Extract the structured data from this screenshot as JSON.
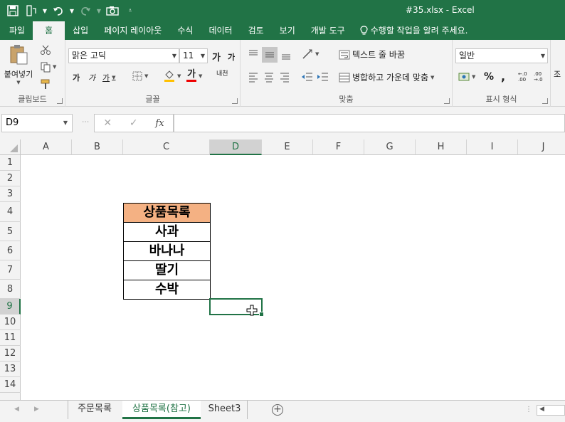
{
  "app": {
    "title": "#35.xlsx - Excel"
  },
  "ribbon_tabs": [
    {
      "label": "파일"
    },
    {
      "label": "홈"
    },
    {
      "label": "삽입"
    },
    {
      "label": "페이지 레이아웃"
    },
    {
      "label": "수식"
    },
    {
      "label": "데이터"
    },
    {
      "label": "검토"
    },
    {
      "label": "보기"
    },
    {
      "label": "개발 도구"
    }
  ],
  "tell_me": "수행할 작업을 알려 주세요.",
  "clipboard": {
    "paste_label": "붙여넣기",
    "group_label": "클립보드"
  },
  "font": {
    "name": "맑은 고딕",
    "size": "11",
    "bold": "가",
    "italic": "가",
    "underline": "가",
    "grow": "가",
    "shrink": "가",
    "color_letter": "가",
    "phonetic": "내천",
    "group_label": "글꼴"
  },
  "alignment": {
    "wrap_text": "텍스트 줄 바꿈",
    "merge_center": "병합하고 가운데 맞춤",
    "group_label": "맞춤"
  },
  "number": {
    "format": "일반",
    "percent": "%",
    "comma": ",",
    "inc_decimal": "←.0 .00",
    "dec_decimal": ".00 →.0",
    "group_label": "표시 형식"
  },
  "cut_label": "조",
  "formula_bar": {
    "name_box": "D9",
    "cancel": "✕",
    "enter": "✓",
    "fx": "fx",
    "content": ""
  },
  "columns": [
    "A",
    "B",
    "C",
    "D",
    "E",
    "F",
    "G",
    "H",
    "I",
    "J"
  ],
  "rows": [
    "1",
    "2",
    "3",
    "4",
    "5",
    "6",
    "7",
    "8",
    "9",
    "10",
    "11",
    "12",
    "13",
    "14"
  ],
  "table": {
    "header": "상품목록",
    "items": [
      "사과",
      "바나나",
      "딸기",
      "수박"
    ]
  },
  "sheets": [
    {
      "label": "주문목록",
      "active": false
    },
    {
      "label": "상품목록(참고)",
      "active": true
    },
    {
      "label": "Sheet3",
      "active": false
    }
  ],
  "colors": {
    "accent": "#217346",
    "table_header_fill": "#f4b183"
  }
}
